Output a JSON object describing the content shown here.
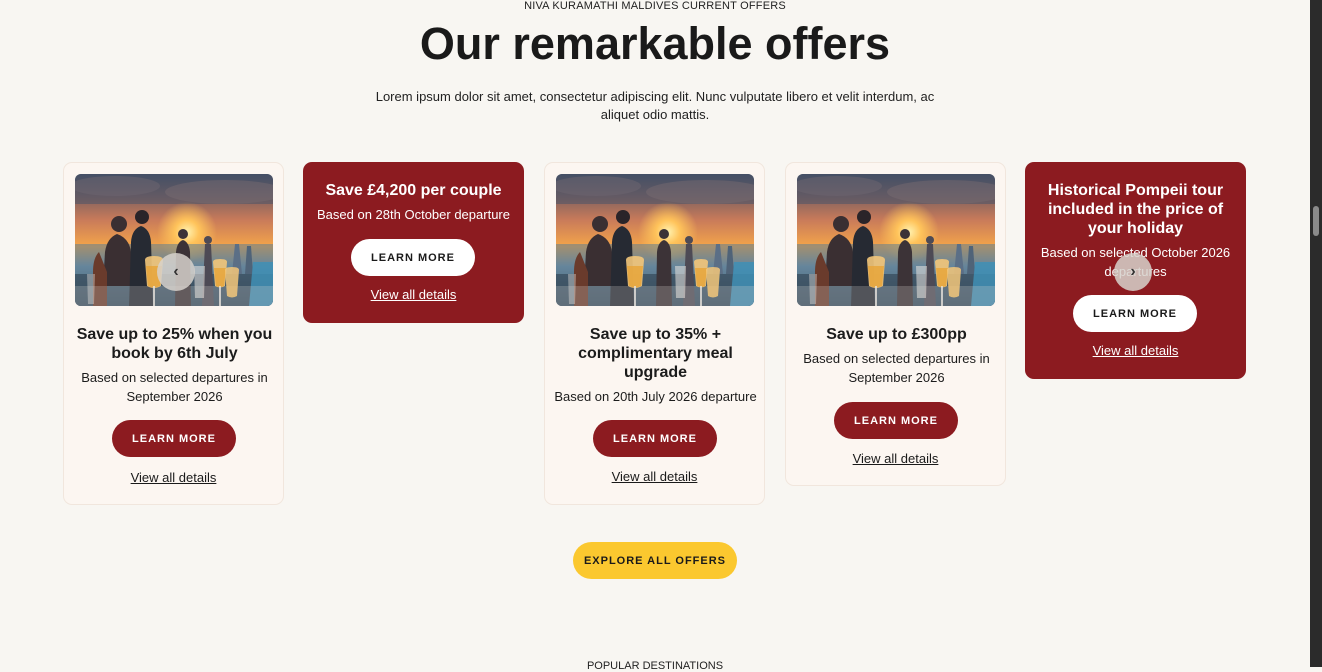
{
  "header": {
    "eyebrow": "NIVA KURAMATHI MALDIVES CURRENT OFFERS",
    "title": "Our remarkable offers",
    "intro": "Lorem ipsum dolor sit amet, consectetur adipiscing elit. Nunc vulputate libero et velit interdum, ac aliquet odio mattis."
  },
  "cards": [
    {
      "image": "sunset-beach-party-photo",
      "title": "Save up to 25% when you book by 6th July",
      "subtitle": "Based on selected departures in September 2026",
      "button": "LEARN MORE",
      "link": "View all details"
    },
    {
      "title": "Save £4,200 per couple",
      "subtitle": "Based on 28th October departure",
      "button": "LEARN MORE",
      "link": "View all details"
    },
    {
      "image": "sunset-beach-party-photo",
      "title": "Save up to 35% + complimentary meal upgrade",
      "subtitle": "Based on 20th July 2026 departure",
      "button": "LEARN MORE",
      "link": "View all details"
    },
    {
      "image": "sunset-beach-party-photo",
      "title": "Save up to £300pp",
      "subtitle": "Based on selected departures in September 2026",
      "button": "LEARN MORE",
      "link": "View all details"
    },
    {
      "title": "Historical Pompeii tour included in the price of your holiday",
      "subtitle": "Based on selected October 2026 departures",
      "button": "LEARN MORE",
      "link": "View all details"
    }
  ],
  "carousel": {
    "prev_icon": "chevron-left-icon",
    "next_icon": "chevron-right-icon"
  },
  "explore_button": "EXPLORE ALL OFFERS",
  "next_section": "POPULAR DESTINATIONS",
  "colors": {
    "brand_red": "#8c1b20",
    "accent_yellow": "#fbc82f",
    "page_bg": "#f8f6f2",
    "card_bg": "#fcf6f1"
  }
}
